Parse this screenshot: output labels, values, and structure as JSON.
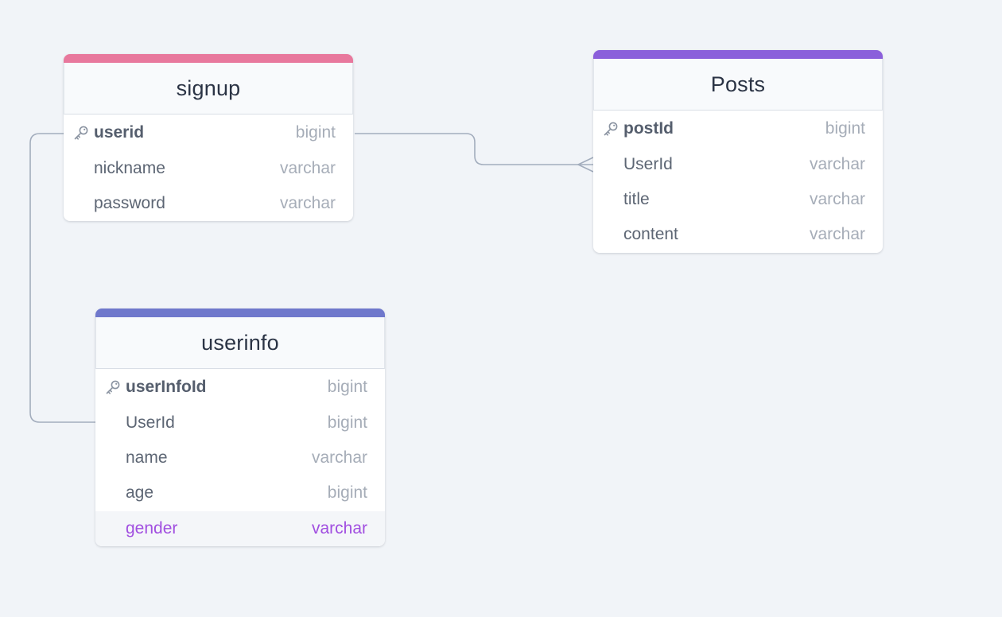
{
  "diagram": {
    "tables": [
      {
        "id": "signup",
        "name": "signup",
        "accent_color": "#e8789d",
        "fields": [
          {
            "name": "userid",
            "type": "bigint",
            "primary_key": true,
            "highlighted": false
          },
          {
            "name": "nickname",
            "type": "varchar",
            "primary_key": false,
            "highlighted": false
          },
          {
            "name": "password",
            "type": "varchar",
            "primary_key": false,
            "highlighted": false
          }
        ]
      },
      {
        "id": "posts",
        "name": "Posts",
        "accent_color": "#8b5fdb",
        "fields": [
          {
            "name": "postId",
            "type": "bigint",
            "primary_key": true,
            "highlighted": false
          },
          {
            "name": "UserId",
            "type": "varchar",
            "primary_key": false,
            "highlighted": false
          },
          {
            "name": "title",
            "type": "varchar",
            "primary_key": false,
            "highlighted": false
          },
          {
            "name": "content",
            "type": "varchar",
            "primary_key": false,
            "highlighted": false
          }
        ]
      },
      {
        "id": "userinfo",
        "name": "userinfo",
        "accent_color": "#6f78cc",
        "fields": [
          {
            "name": "userInfoId",
            "type": "bigint",
            "primary_key": true,
            "highlighted": false
          },
          {
            "name": "UserId",
            "type": "bigint",
            "primary_key": false,
            "highlighted": false
          },
          {
            "name": "name",
            "type": "varchar",
            "primary_key": false,
            "highlighted": false
          },
          {
            "name": "age",
            "type": "bigint",
            "primary_key": false,
            "highlighted": false
          },
          {
            "name": "gender",
            "type": "varchar",
            "primary_key": false,
            "highlighted": true
          }
        ]
      }
    ],
    "relationships": [
      {
        "from_table": "signup",
        "from_field": "userid",
        "to_table": "posts",
        "to_field": "UserId",
        "cardinality": "one-to-many"
      },
      {
        "from_table": "signup",
        "from_field": "userid",
        "to_table": "userinfo",
        "to_field": "UserId",
        "cardinality": "one-to-one"
      }
    ],
    "colors": {
      "background": "#f1f4f8",
      "connector": "#a3adbd",
      "highlight_text": "#a14fe0"
    }
  }
}
